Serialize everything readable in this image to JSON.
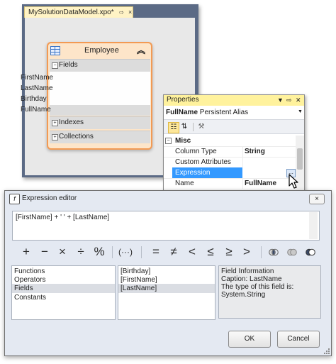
{
  "designer": {
    "tab_title": "MySolutionDataModel.xpo*",
    "pin_glyph": "⇨",
    "close_glyph": "×"
  },
  "entity": {
    "name": "Employee",
    "collapse_glyph": "»",
    "sections": [
      {
        "label": "Fields",
        "state": "−"
      },
      {
        "label": "Indexes",
        "state": "+"
      },
      {
        "label": "Collections",
        "state": "+"
      }
    ],
    "fields": [
      "FirstName",
      "LastName",
      "Birthday",
      "FullName"
    ],
    "selected_field": "FullName"
  },
  "properties": {
    "title": "Properties",
    "selected_object_name": "FullName",
    "selected_object_type": "Persistent Alias",
    "category": "Misc",
    "rows": [
      {
        "name": "Column Type",
        "value": "String"
      },
      {
        "name": "Custom Attributes",
        "value": ""
      },
      {
        "name": "Expression",
        "value": ""
      },
      {
        "name": "Name",
        "value": "FullName"
      }
    ],
    "ellipsis": "..."
  },
  "expression_editor": {
    "title": "Expression editor",
    "close_glyph": "×",
    "expression": "[FirstName] + ' ' + [LastName]",
    "operators": [
      "+",
      "−",
      "×",
      "÷",
      "%",
      "(···)",
      "=",
      "≠",
      "<",
      "≤",
      "≥",
      ">"
    ],
    "categories": [
      "Functions",
      "Operators",
      "Fields",
      "Constants"
    ],
    "selected_category": "Fields",
    "items": [
      "[Birthday]",
      "[FirstName]",
      "[LastName]"
    ],
    "selected_item": "[LastName]",
    "info_lines": [
      "Field Information",
      "Caption: LastName",
      "The type of this field is:",
      "System.String"
    ],
    "ok_label": "OK",
    "cancel_label": "Cancel"
  },
  "colors": {
    "accent_selection": "#3399ff",
    "entity_border": "#f39a53",
    "properties_title_bg": "#fff29d",
    "designer_bg": "#5b6a85"
  }
}
